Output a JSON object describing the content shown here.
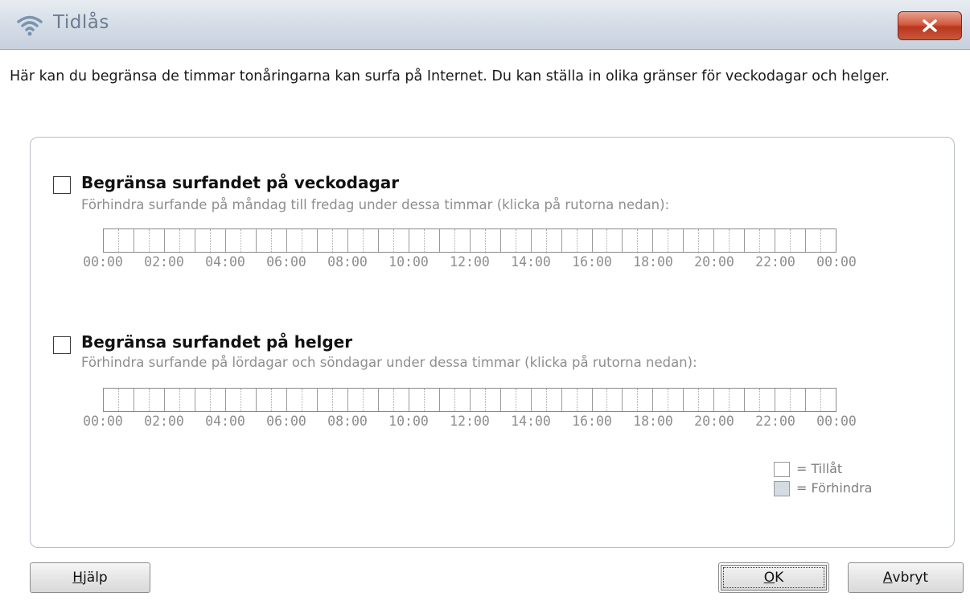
{
  "window": {
    "title": "Tidlås",
    "close_icon": "close-x-icon",
    "app_icon": "wifi-signal-icon"
  },
  "intro_text": "Här kan du begränsa de timmar tonåringarna kan surfa på Internet. Du kan ställa in olika gränser för veckodagar och helger.",
  "weekdays": {
    "checked": false,
    "title": "Begränsa surfandet på veckodagar",
    "description": "Förhindra surfande på måndag till fredag under dessa timmar (klicka på rutorna nedan):"
  },
  "weekends": {
    "checked": false,
    "title": "Begränsa surfandet på helger",
    "description": "Förhindra surfande på lördagar och söndagar under dessa timmar (klicka på rutorna nedan):"
  },
  "time_labels": [
    "00:00",
    "02:00",
    "04:00",
    "06:00",
    "08:00",
    "10:00",
    "12:00",
    "14:00",
    "16:00",
    "18:00",
    "20:00",
    "22:00",
    "00:00"
  ],
  "legend": {
    "allow_label": "= Tillåt",
    "block_label": "= Förhindra",
    "allow_color": "#ffffff",
    "block_color": "#d4dbe3"
  },
  "buttons": {
    "help_mnemonic": "H",
    "help_rest": "jälp",
    "ok_mnemonic": "O",
    "ok_rest": "K",
    "cancel_mnemonic": "A",
    "cancel_rest": "vbryt"
  }
}
